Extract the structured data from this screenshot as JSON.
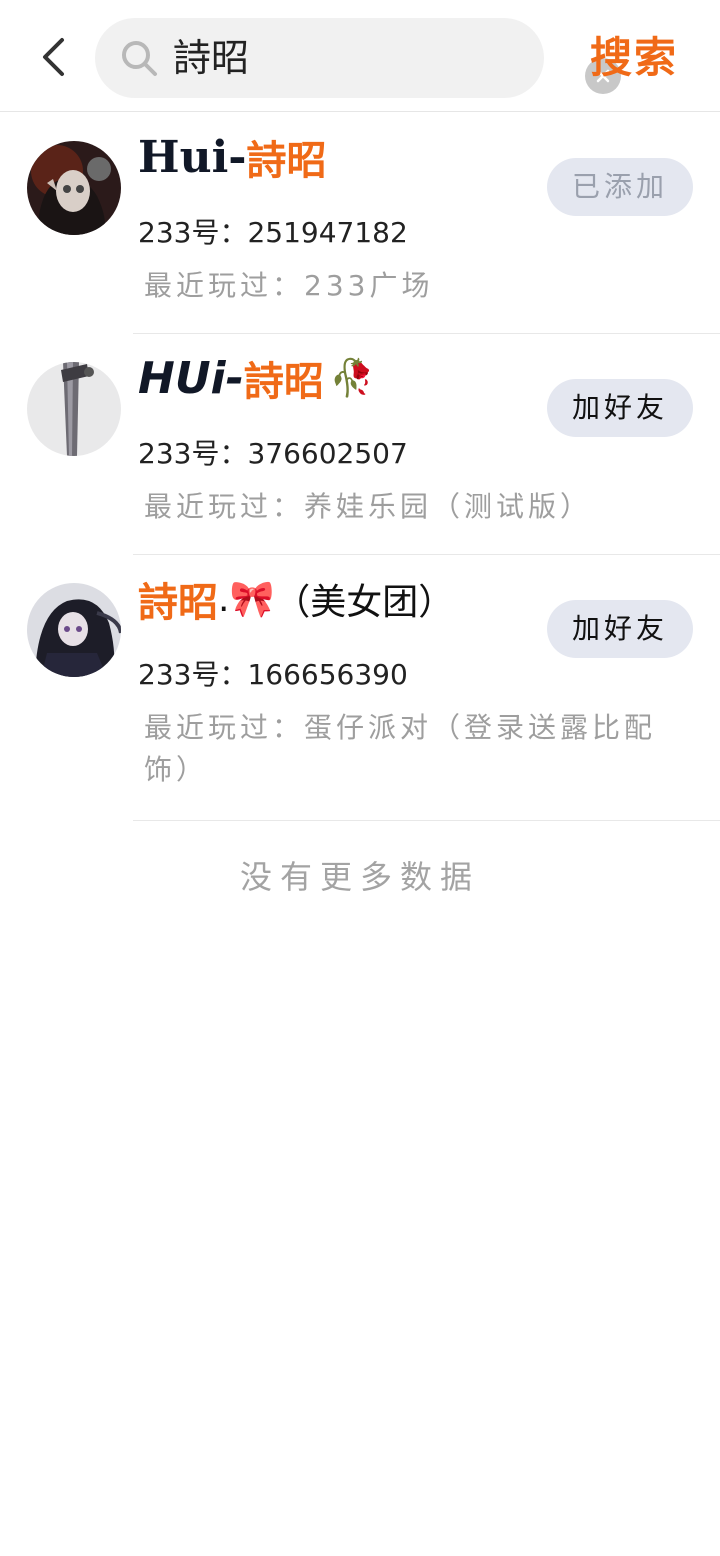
{
  "header": {
    "search_value": "詩昭",
    "search_button": "搜索"
  },
  "results": [
    {
      "name_latin": "Hui-",
      "name_cjk": "詩昭",
      "name_suffix": "",
      "name_emoji": "",
      "id_text": "233号：251947182",
      "played_text": "最近玩过：233广场",
      "action": "已添加"
    },
    {
      "name_latin": "HUi-",
      "name_cjk": "詩昭",
      "name_suffix": "",
      "name_emoji": "🥀",
      "id_text": "233号：376602507",
      "played_text": "最近玩过：养娃乐园（测试版）",
      "action": "加好友"
    },
    {
      "name_latin": "",
      "name_cjk": "詩昭",
      "name_suffix": ".",
      "name_emoji": "🎀",
      "name_tail": "（美女团）",
      "id_text": "233号：166656390",
      "played_text": "最近玩过：蛋仔派对（登录送露比配饰）",
      "action": "加好友"
    }
  ],
  "footer": {
    "no_more": "没有更多数据"
  },
  "colors": {
    "accent": "#f06a17",
    "button_bg": "#e4e7f0",
    "muted_text": "#9e9e9e"
  }
}
